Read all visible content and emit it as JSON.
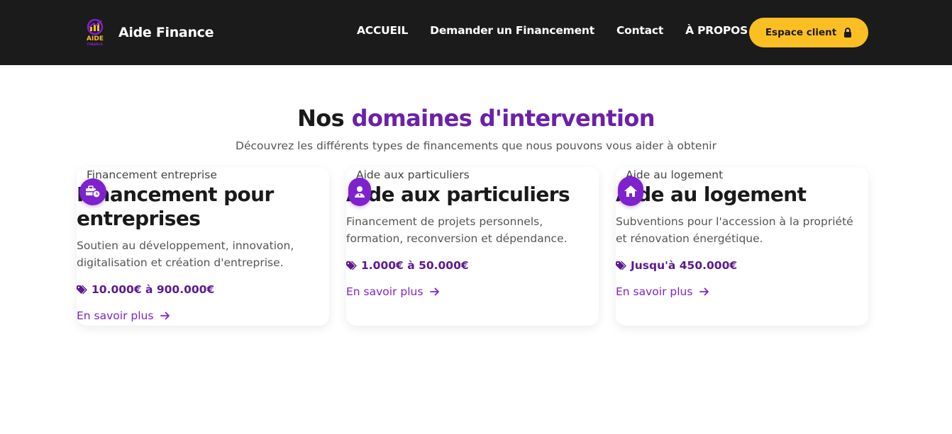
{
  "header": {
    "brand": "Aide Finance",
    "logo_text": "AIDE",
    "logo_subtext": "FINANCE",
    "nav": [
      "ACCUEIL",
      "Demander un Financement",
      "Contact",
      "À PROPOS"
    ],
    "cta": "Espace client"
  },
  "section": {
    "title_plain": "Nos ",
    "title_accent": "domaines d'intervention",
    "subtitle": "Découvrez les différents types de financements que nous pouvons vous aider à obtenir"
  },
  "cards": [
    {
      "image_alt": "Financement entreprise",
      "icon": "briefcase-clock-icon",
      "title": "Financement pour entreprises",
      "description": "Soutien au développement, innovation, digitalisation et création d'entreprise.",
      "price": "10.000€ à 900.000€",
      "link": "En savoir plus"
    },
    {
      "image_alt": "Aide aux particuliers",
      "icon": "user-tie-icon",
      "title": "Aide aux particuliers",
      "description": "Financement de projets personnels, formation, reconversion et dépendance.",
      "price": "1.000€ à 50.000€",
      "link": "En savoir plus"
    },
    {
      "image_alt": "Aide au logement",
      "icon": "home-icon",
      "title": "Aide au logement",
      "description": "Subventions pour l'accession à la propriété et rénovation énergétique.",
      "price": "Jusqu'à 450.000€",
      "link": "En savoir plus"
    }
  ],
  "colors": {
    "header_bg": "#1b1b1b",
    "accent_purple": "#6b21a8",
    "badge_purple": "#7e22ce",
    "cta_yellow": "#fbbf24"
  }
}
